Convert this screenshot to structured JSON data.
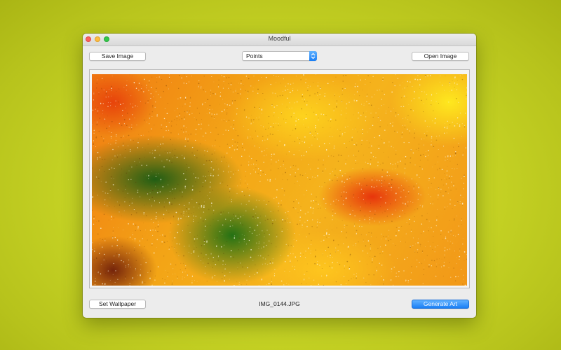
{
  "window": {
    "title": "Moodful"
  },
  "toolbar": {
    "save_image_label": "Save Image",
    "mode_selected": "Points",
    "open_image_label": "Open Image"
  },
  "footer": {
    "set_wallpaper_label": "Set Wallpaper",
    "filename": "IMG_0144.JPG",
    "generate_art_label": "Generate Art"
  },
  "colors": {
    "accent": "#1b7ff5",
    "desktop_background": "#c9d626",
    "close": "#fc605c",
    "minimize": "#fdbc40",
    "zoom": "#34c84a"
  },
  "icons": {
    "popup_arrows": "up-down-chevron-icon"
  }
}
